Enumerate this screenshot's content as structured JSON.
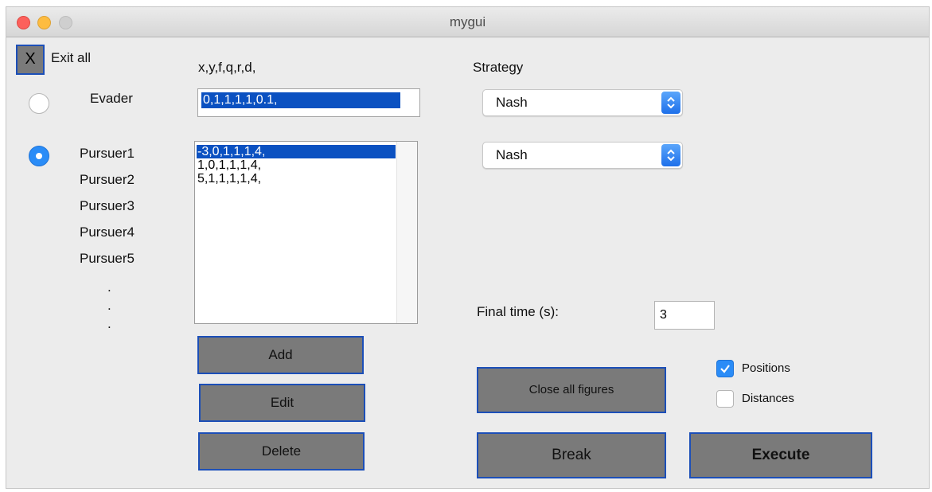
{
  "window": {
    "title": "mygui"
  },
  "exit": {
    "icon_label": "X",
    "label": "Exit all"
  },
  "params_header": "x,y,f,q,r,d,",
  "strategy_header": "Strategy",
  "evader": {
    "label": "Evader",
    "selected": false,
    "value": "0,1,1,1,1,0.1,",
    "strategy": "Nash"
  },
  "pursuers": {
    "selected": true,
    "labels": [
      "Pursuer1",
      "Pursuer2",
      "Pursuer3",
      "Pursuer4",
      "Pursuer5"
    ],
    "ellipsis": ".",
    "list": [
      "-3,0,1,1,1,4,",
      "1,0,1,1,1,4,",
      "5,1,1,1,1,4,"
    ],
    "selected_index": 0,
    "strategy": "Nash"
  },
  "buttons": {
    "add": "Add",
    "edit": "Edit",
    "delete": "Delete",
    "close_figures": "Close all figures",
    "break": "Break",
    "execute": "Execute"
  },
  "final_time": {
    "label": "Final time (s):",
    "value": "3"
  },
  "plots": {
    "positions": {
      "label": "Positions",
      "checked": true
    },
    "distances": {
      "label": "Distances",
      "checked": false
    }
  },
  "colors": {
    "accent": "#2a8cf7",
    "selection": "#0b51c1",
    "button_gray": "#7a7a7a",
    "button_border": "#1c4fb8"
  }
}
